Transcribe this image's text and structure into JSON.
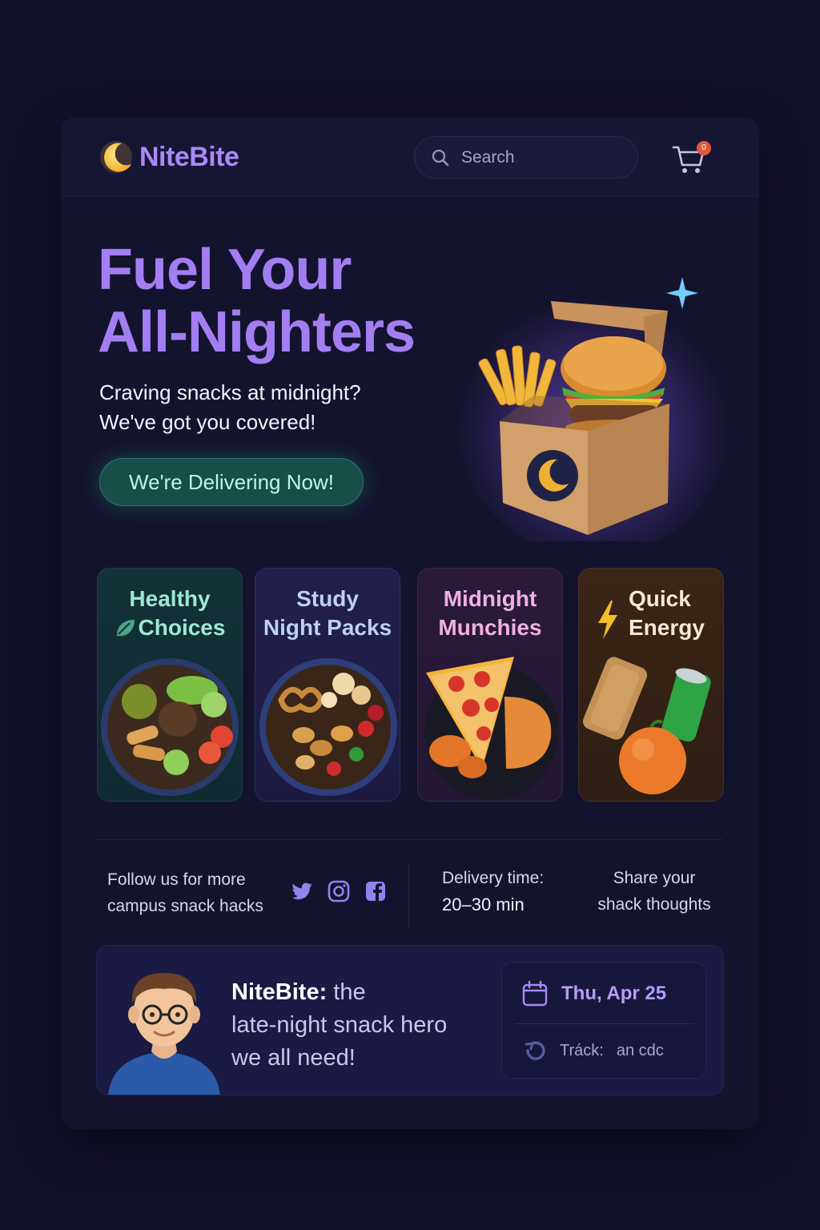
{
  "app": {
    "name": "NiteBite"
  },
  "header": {
    "search_placeholder": "Search",
    "cart_badge": "0"
  },
  "hero": {
    "title_line1": "Fuel Your",
    "title_line2": "All-Nighters",
    "subtitle_line1": "Craving snacks at midnight?",
    "subtitle_line2": "We've got you covered!",
    "cta": "We're Delivering Now!"
  },
  "categories": [
    {
      "line1": "Healthy",
      "line2": "Choices",
      "icon": "leaf-icon"
    },
    {
      "line1": "Study",
      "line2": "Night Packs",
      "icon": ""
    },
    {
      "line1": "Midnight",
      "line2": "Munchies",
      "icon": ""
    },
    {
      "line1": "Quick",
      "line2": "Energy",
      "icon": "lightning-icon"
    }
  ],
  "info": {
    "follow_line1": "Follow us for more",
    "follow_line2": "campus snack hacks",
    "socials": [
      "twitter-icon",
      "instagram-icon",
      "facebook-icon"
    ],
    "delivery_label": "Delivery time:",
    "delivery_value": "20–30 min",
    "share_line1": "Share your",
    "share_line2": "shack thoughts"
  },
  "testimonial": {
    "brand": "NiteBite:",
    "text_line1": " the",
    "text_line2": "late-night snack hero",
    "text_line3": "we all need!",
    "date": "Thu, Apr 25",
    "track_label": "Tráck:",
    "track_value": "an cdc"
  },
  "colors": {
    "background": "#12112a",
    "accent_purple": "#a27ef2",
    "cta_green": "#174f47",
    "badge_red": "#e2573e"
  }
}
